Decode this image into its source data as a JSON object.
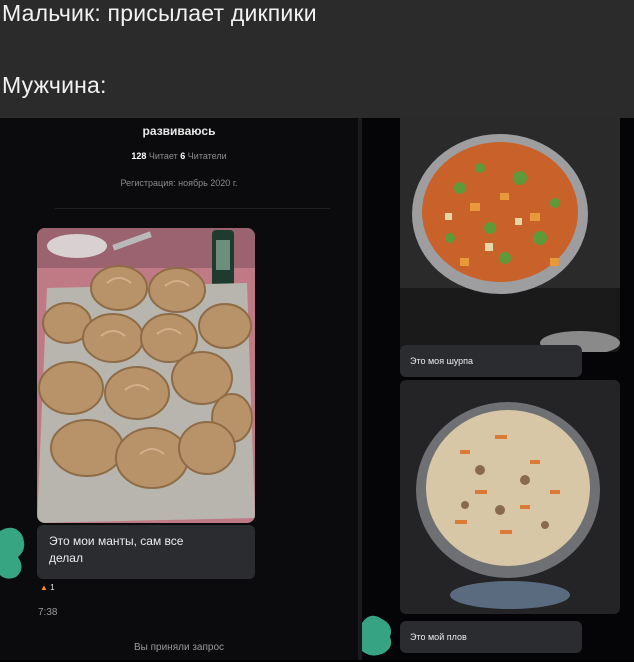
{
  "meme": {
    "line1": "Мальчик: присылает дикпики",
    "line2": "Мужчина:"
  },
  "profile": {
    "status": "развиваюсь",
    "following_count": "128",
    "following_label": "Читает",
    "followers_count": "6",
    "followers_label": "Читатели",
    "registration": "Регистрация: ноябрь 2020 г."
  },
  "messages": [
    {
      "text": "Это мои манты, сам все делал",
      "reaction": "1",
      "time": "7:38"
    },
    {
      "text": "Это моя шурпа"
    },
    {
      "text": "Это мой плов"
    }
  ],
  "footer": {
    "request_accepted": "Вы приняли запрос"
  },
  "colors": {
    "caption_bg": "#2b2b2b",
    "bubble_bg": "#2a2c30",
    "chat_bg": "#0b0b0d",
    "redaction": "#3fbf98"
  }
}
